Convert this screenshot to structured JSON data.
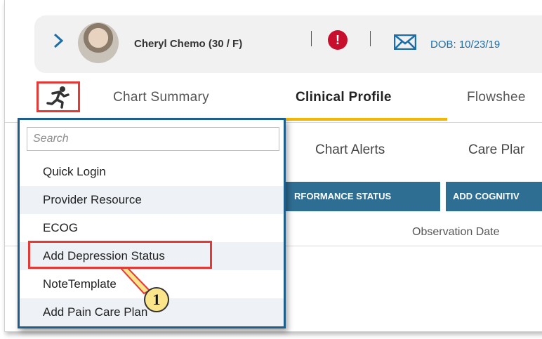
{
  "patient": {
    "name": "Cheryl Chemo (30 / F)",
    "dob": "DOB: 10/23/19"
  },
  "tabs": [
    {
      "label": "Chart Summary"
    },
    {
      "label": "Clinical Profile"
    },
    {
      "label": "Flowshee"
    }
  ],
  "subtabs": [
    {
      "label": "Chart Alerts"
    },
    {
      "label": "Care Plar"
    }
  ],
  "buttons": [
    {
      "label": "RFORMANCE STATUS"
    },
    {
      "label": "ADD COGNITIV"
    }
  ],
  "table": {
    "column_header": "Observation Date"
  },
  "dropdown": {
    "search_placeholder": "Search",
    "items": [
      {
        "label": "Quick Login"
      },
      {
        "label": "Provider Resource"
      },
      {
        "label": "ECOG"
      },
      {
        "label": "Add Depression Status"
      },
      {
        "label": "NoteTemplate"
      },
      {
        "label": "Add Pain Care Plan"
      }
    ]
  },
  "callout": {
    "number": "1"
  },
  "colors": {
    "accent": "#1d5e8c",
    "highlight": "#e53935",
    "tab_underline": "#f2b705",
    "button": "#2f6e93",
    "alert": "#c8102e"
  }
}
